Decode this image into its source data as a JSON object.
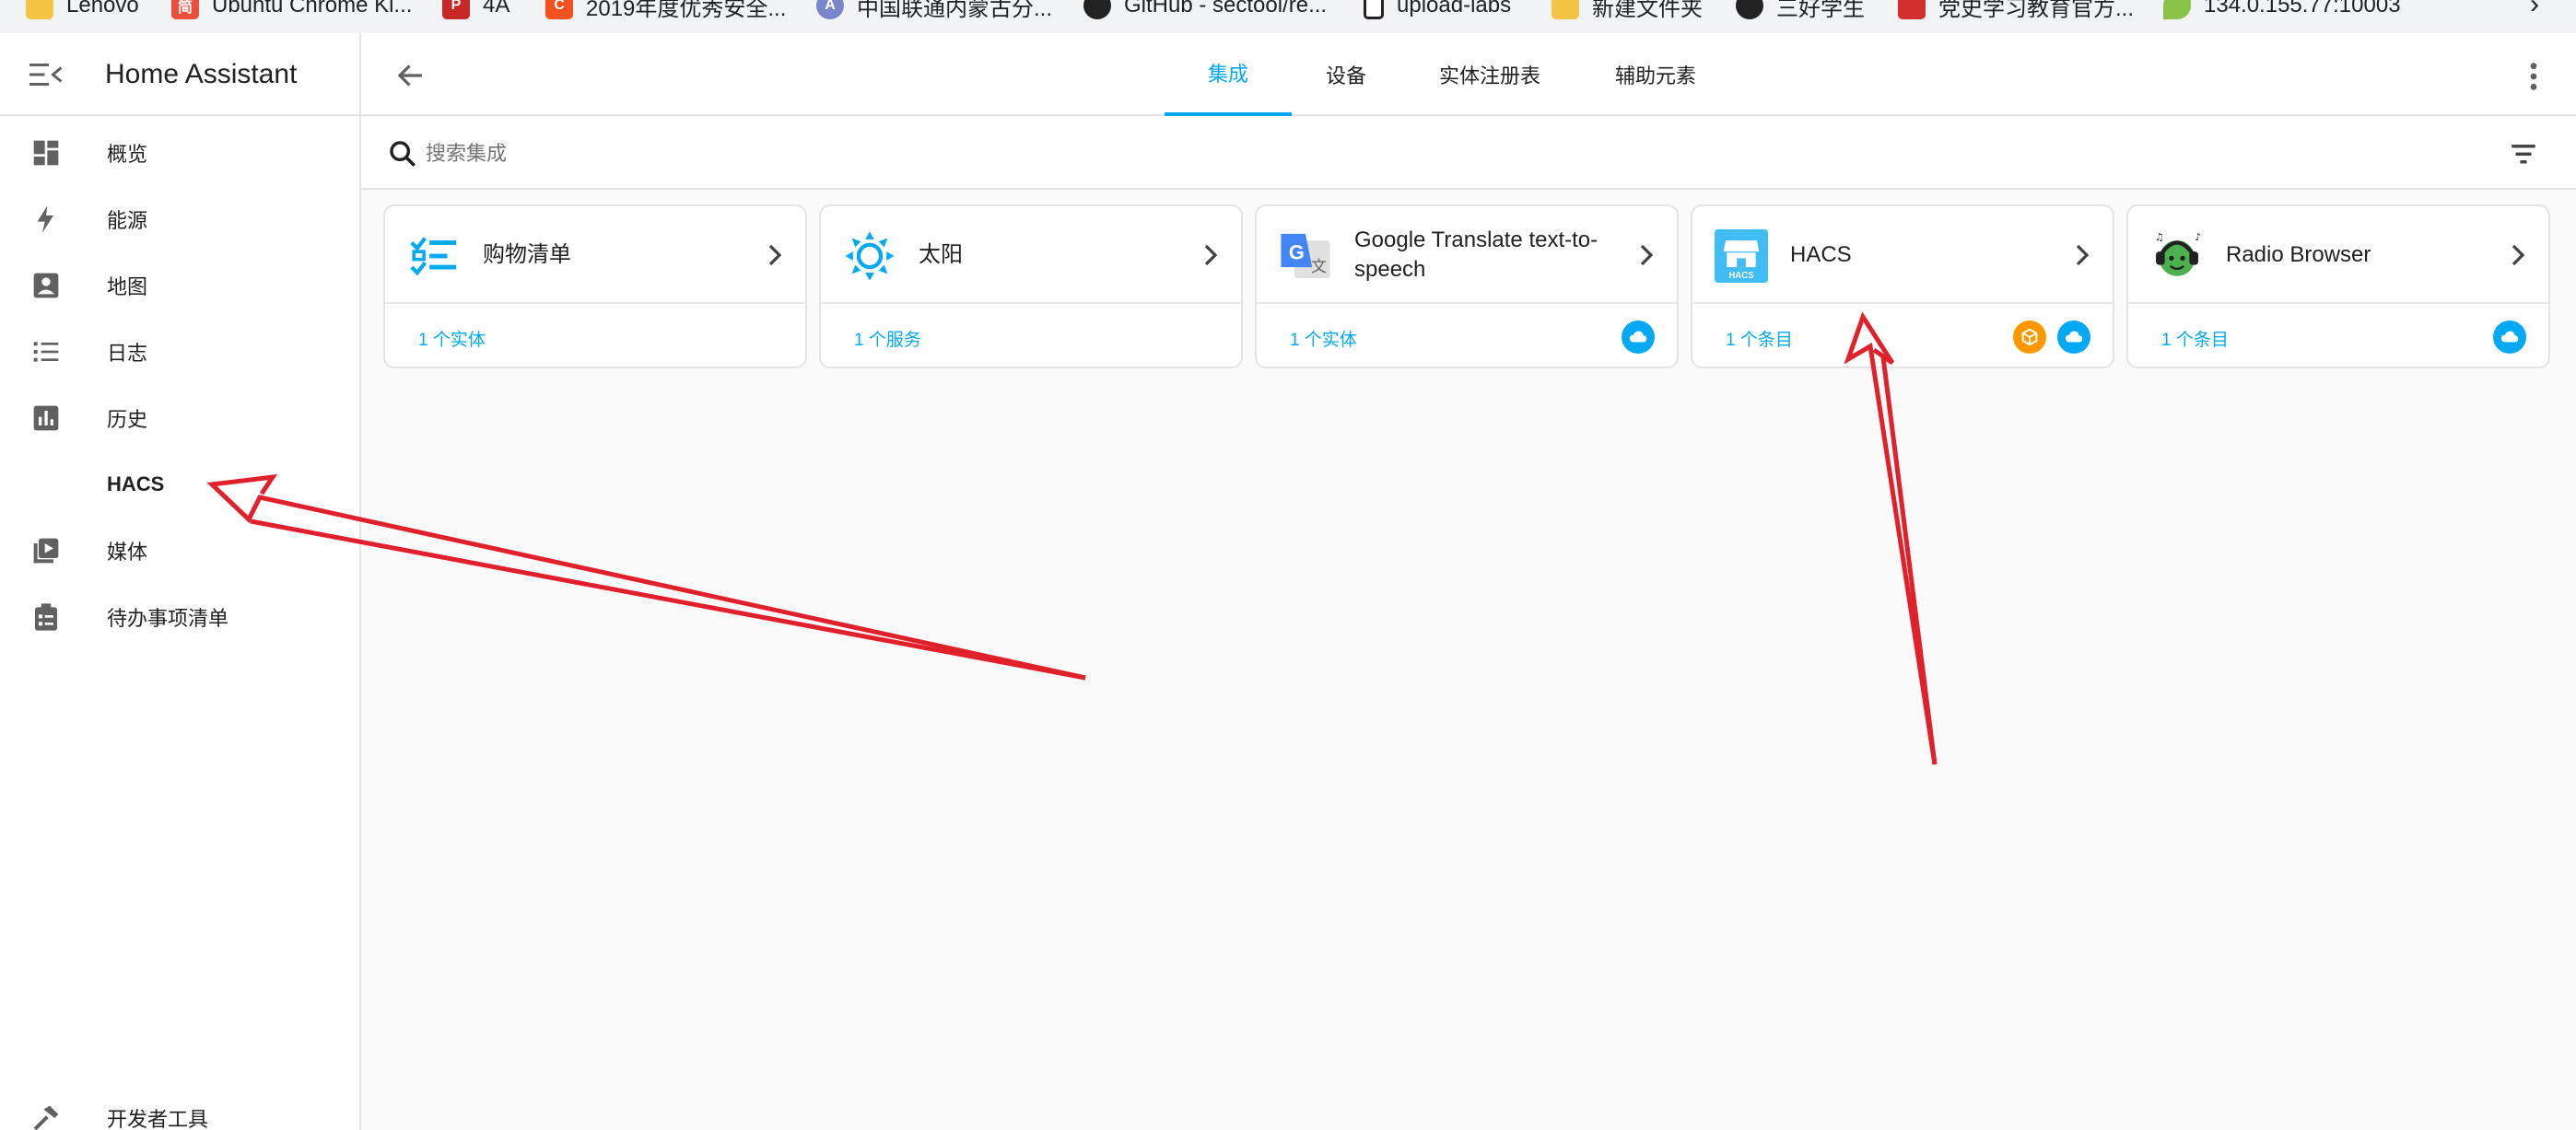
{
  "bookmarks": [
    {
      "label": "Lenovo",
      "icon": "folder-icon",
      "color": "#f6c445"
    },
    {
      "label": "Ubuntu Chrome Ki...",
      "icon": "ubuntu-app-icon",
      "color": "#e94f3d"
    },
    {
      "label": "4A",
      "icon": "pdf-icon",
      "color": "#c62828"
    },
    {
      "label": "2019年度优秀安全...",
      "icon": "c-logo-icon",
      "color": "#f4511e"
    },
    {
      "label": "中国联通内蒙古分...",
      "icon": "a-logo-icon",
      "color": "#7986cb"
    },
    {
      "label": "GitHub - sectool/re...",
      "icon": "github-icon",
      "color": "#222222"
    },
    {
      "label": "upload-labs",
      "icon": "page-icon",
      "color": "#ffffff"
    },
    {
      "label": "新建文件夹",
      "icon": "folder-icon",
      "color": "#f6c445"
    },
    {
      "label": "三好学生",
      "icon": "github-icon",
      "color": "#222222"
    },
    {
      "label": "党史学习教育官方...",
      "icon": "party-icon",
      "color": "#d32f2f"
    },
    {
      "label": "134.0.155.77:10003",
      "icon": "leaf-icon",
      "color": "#8bc34a"
    }
  ],
  "sidebar": {
    "title": "Home Assistant",
    "items": [
      {
        "label": "概览",
        "icon": "dashboard-icon"
      },
      {
        "label": "能源",
        "icon": "lightning-icon"
      },
      {
        "label": "地图",
        "icon": "map-icon"
      },
      {
        "label": "日志",
        "icon": "list-icon"
      },
      {
        "label": "历史",
        "icon": "chart-icon"
      },
      {
        "label": "HACS",
        "icon": "none"
      },
      {
        "label": "媒体",
        "icon": "media-icon"
      },
      {
        "label": "待办事项清单",
        "icon": "clipboard-icon"
      }
    ],
    "dev_tools": "开发者工具"
  },
  "tabs": [
    {
      "label": "集成",
      "active": true
    },
    {
      "label": "设备",
      "active": false
    },
    {
      "label": "实体注册表",
      "active": false
    },
    {
      "label": "辅助元素",
      "active": false
    }
  ],
  "search": {
    "placeholder": "搜索集成",
    "value": ""
  },
  "cards": [
    {
      "title": "购物清单",
      "link": "1 个实体",
      "logo": "checklist-icon",
      "badges": []
    },
    {
      "title": "太阳",
      "link": "1 个服务",
      "logo": "sun-icon",
      "badges": []
    },
    {
      "title": "Google Translate text-to-speech",
      "link": "1 个实体",
      "logo": "google-translate-icon",
      "badges": [
        "cloud-icon"
      ]
    },
    {
      "title": "HACS",
      "link": "1 个条目",
      "logo": "hacs-icon",
      "badges": [
        "custom-component-icon",
        "cloud-icon"
      ]
    },
    {
      "title": "Radio Browser",
      "link": "1 个条目",
      "logo": "radio-browser-icon",
      "badges": [
        "cloud-icon"
      ]
    }
  ],
  "colors": {
    "accent": "#03a9f4",
    "annotation": "#e0202a",
    "custom_badge": "#ff9800"
  }
}
